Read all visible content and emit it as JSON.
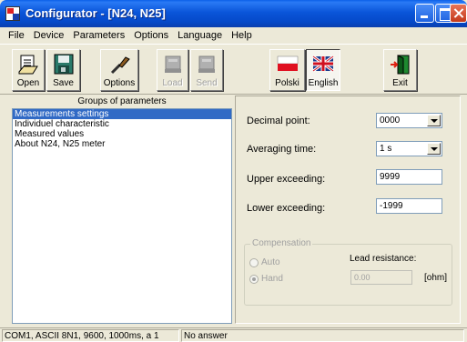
{
  "window": {
    "title": "Configurator - [N24, N25]"
  },
  "menu": [
    {
      "label": "File"
    },
    {
      "label": "Device"
    },
    {
      "label": "Parameters"
    },
    {
      "label": "Options"
    },
    {
      "label": "Language"
    },
    {
      "label": "Help"
    }
  ],
  "toolbar": {
    "open": {
      "label": "Open",
      "icon": "open-icon"
    },
    "save": {
      "label": "Save",
      "icon": "floppy-icon"
    },
    "options": {
      "label": "Options",
      "icon": "screwdriver-icon"
    },
    "load": {
      "label": "Load",
      "icon": "load-icon",
      "enabled": false
    },
    "send": {
      "label": "Send",
      "icon": "send-icon",
      "enabled": false
    },
    "polski": {
      "label": "Polski",
      "icon": "poland-flag-icon"
    },
    "english": {
      "label": "English",
      "icon": "uk-flag-icon",
      "pressed": true
    },
    "exit": {
      "label": "Exit",
      "icon": "exit-door-icon"
    }
  },
  "groups": {
    "header": "Groups of parameters",
    "items": [
      {
        "label": "Measurements settings",
        "selected": true
      },
      {
        "label": "Individuel characteristic"
      },
      {
        "label": "Measured values"
      },
      {
        "label": "About N24, N25 meter"
      }
    ]
  },
  "settings": {
    "decimal_point": {
      "label": "Decimal point:",
      "value": "0000"
    },
    "averaging_time": {
      "label": "Averaging time:",
      "value": "1 s"
    },
    "upper_exceeding": {
      "label": "Upper exceeding:",
      "value": "9999"
    },
    "lower_exceeding": {
      "label": "Lower exceeding:",
      "value": "-1999"
    }
  },
  "compensation": {
    "title": "Compensation",
    "auto_label": "Auto",
    "hand_label": "Hand",
    "selected": "Hand",
    "lead_resistance_label": "Lead resistance:",
    "lead_resistance_value": "0.00",
    "unit": "[ohm]",
    "enabled": false
  },
  "status": {
    "connection": "COM1, ASCII 8N1, 9600, 1000ms, a 1",
    "answer": "No answer"
  }
}
